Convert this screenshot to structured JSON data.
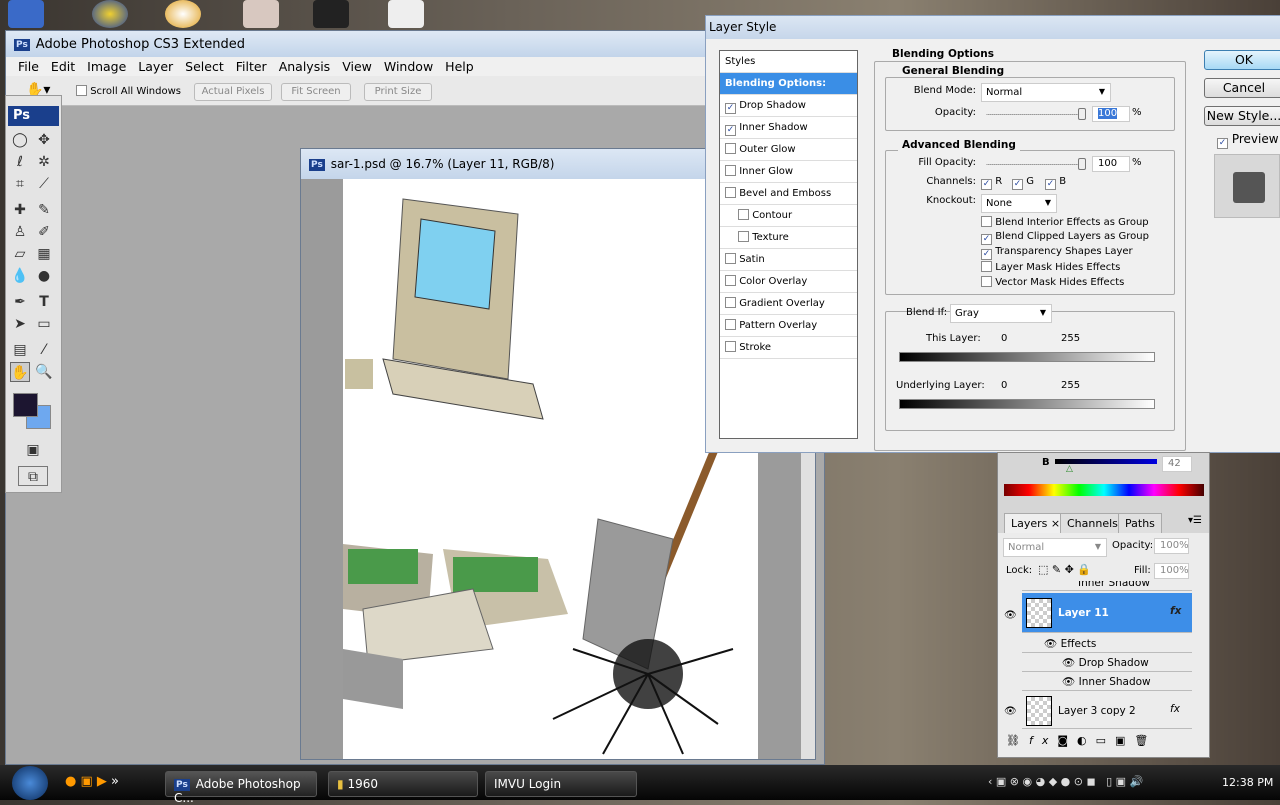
{
  "app": {
    "title": "Adobe Photoshop CS3 Extended",
    "logo": "Ps"
  },
  "menu": [
    "File",
    "Edit",
    "Image",
    "Layer",
    "Select",
    "Filter",
    "Analysis",
    "View",
    "Window",
    "Help"
  ],
  "options": {
    "scroll_all": "Scroll All Windows",
    "scroll_all_checked": false,
    "actual_pixels": "Actual Pixels",
    "fit_screen": "Fit Screen",
    "print_size": "Print Size"
  },
  "toolbox": {
    "logo": "Ps",
    "foreground_color": "#1c1530",
    "background_color": "#6ea8ef"
  },
  "document": {
    "title": "sar-1.psd @ 16.7% (Layer 11, RGB/8)"
  },
  "dialog": {
    "title": "Layer Style",
    "styles": [
      {
        "label": "Styles",
        "checkbox": null
      },
      {
        "label": "Blending Options: Default",
        "checkbox": null,
        "selected": true
      },
      {
        "label": "Drop Shadow",
        "checkbox": true
      },
      {
        "label": "Inner Shadow",
        "checkbox": true
      },
      {
        "label": "Outer Glow",
        "checkbox": false
      },
      {
        "label": "Inner Glow",
        "checkbox": false
      },
      {
        "label": "Bevel and Emboss",
        "checkbox": false
      },
      {
        "label": "Contour",
        "checkbox": false,
        "indent": true
      },
      {
        "label": "Texture",
        "checkbox": false,
        "indent": true
      },
      {
        "label": "Satin",
        "checkbox": false
      },
      {
        "label": "Color Overlay",
        "checkbox": false
      },
      {
        "label": "Gradient Overlay",
        "checkbox": false
      },
      {
        "label": "Pattern Overlay",
        "checkbox": false
      },
      {
        "label": "Stroke",
        "checkbox": false
      }
    ],
    "blending_options": "Blending Options",
    "general": {
      "title": "General Blending",
      "blend_mode_label": "Blend Mode:",
      "blend_mode": "Normal",
      "opacity_label": "Opacity:",
      "opacity": "100",
      "pct": "%"
    },
    "advanced": {
      "title": "Advanced Blending",
      "fill_label": "Fill Opacity:",
      "fill": "100",
      "pct": "%",
      "channels_label": "Channels:",
      "r": "R",
      "g": "G",
      "b": "B",
      "knockout_label": "Knockout:",
      "knockout": "None",
      "checks": [
        {
          "label": "Blend Interior Effects as Group",
          "checked": false
        },
        {
          "label": "Blend Clipped Layers as Group",
          "checked": true
        },
        {
          "label": "Transparency Shapes Layer",
          "checked": true
        },
        {
          "label": "Layer Mask Hides Effects",
          "checked": false
        },
        {
          "label": "Vector Mask Hides Effects",
          "checked": false
        }
      ]
    },
    "blend_if": {
      "label": "Blend If:",
      "value": "Gray",
      "this_layer": "This Layer:",
      "underlying": "Underlying Layer:",
      "min": "0",
      "max": "255"
    },
    "buttons": {
      "ok": "OK",
      "cancel": "Cancel",
      "new_style": "New Style...",
      "preview": "Preview",
      "preview_checked": true
    }
  },
  "color_panel": {
    "channel": "B",
    "value": "42"
  },
  "layers": {
    "tabs": [
      "Layers",
      "Channels",
      "Paths"
    ],
    "blend_mode": "Normal",
    "opacity_label": "Opacity:",
    "opacity": "100%",
    "lock_label": "Lock:",
    "fill_label": "Fill:",
    "fill": "100%",
    "partial_effect": "Inner Shadow",
    "items": [
      {
        "name": "Layer 11",
        "selected": true,
        "fx": "fx"
      },
      {
        "name": "Layer 3 copy 2",
        "fx": "fx"
      }
    ],
    "effects_label": "Effects",
    "effects": [
      "Drop Shadow",
      "Inner Shadow"
    ]
  },
  "taskbar": {
    "items": [
      "Adobe Photoshop C...",
      "1960",
      "IMVU Login"
    ],
    "clock": "12:38 PM"
  }
}
